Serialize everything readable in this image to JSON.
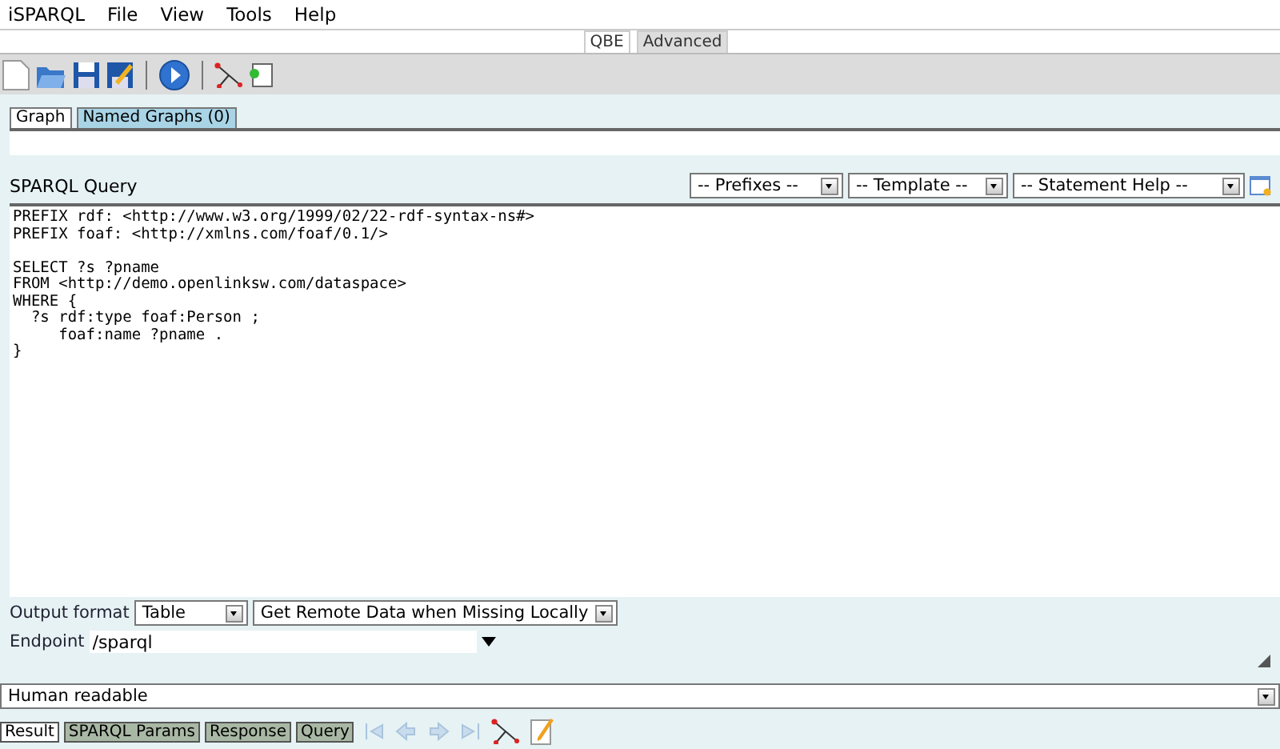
{
  "menu": [
    "iSPARQL",
    "File",
    "View",
    "Tools",
    "Help"
  ],
  "mode_tabs": [
    {
      "label": "QBE",
      "selected": true
    },
    {
      "label": "Advanced",
      "selected": false
    }
  ],
  "graph_tabs": [
    {
      "label": "Graph",
      "selected": true
    },
    {
      "label": "Named Graphs (0)",
      "selected": false
    }
  ],
  "query_label": "SPARQL Query",
  "query_dropdowns": [
    "-- Prefixes --",
    "-- Template --",
    "-- Statement Help --"
  ],
  "query": {
    "value": "PREFIX rdf: <http://www.w3.org/1999/02/22-rdf-syntax-ns#>\nPREFIX foaf: <http://xmlns.com/foaf/0.1/>\n\nSELECT ?s ?pname\nFROM <http://demo.openlinksw.com/dataspace>\nWHERE {\n  ?s rdf:type foaf:Person ;\n     foaf:name ?pname .\n}"
  },
  "output_format": {
    "label": "Output format",
    "format": "Table",
    "remote": "Get Remote Data when Missing Locally"
  },
  "endpoint": {
    "label": "Endpoint",
    "value": "/sparql"
  },
  "display": "Human readable",
  "result_tabs": [
    {
      "label": "Result",
      "selected": true
    },
    {
      "label": "SPARQL Params",
      "selected": false
    },
    {
      "label": "Response",
      "selected": false
    },
    {
      "label": "Query",
      "selected": false
    }
  ]
}
